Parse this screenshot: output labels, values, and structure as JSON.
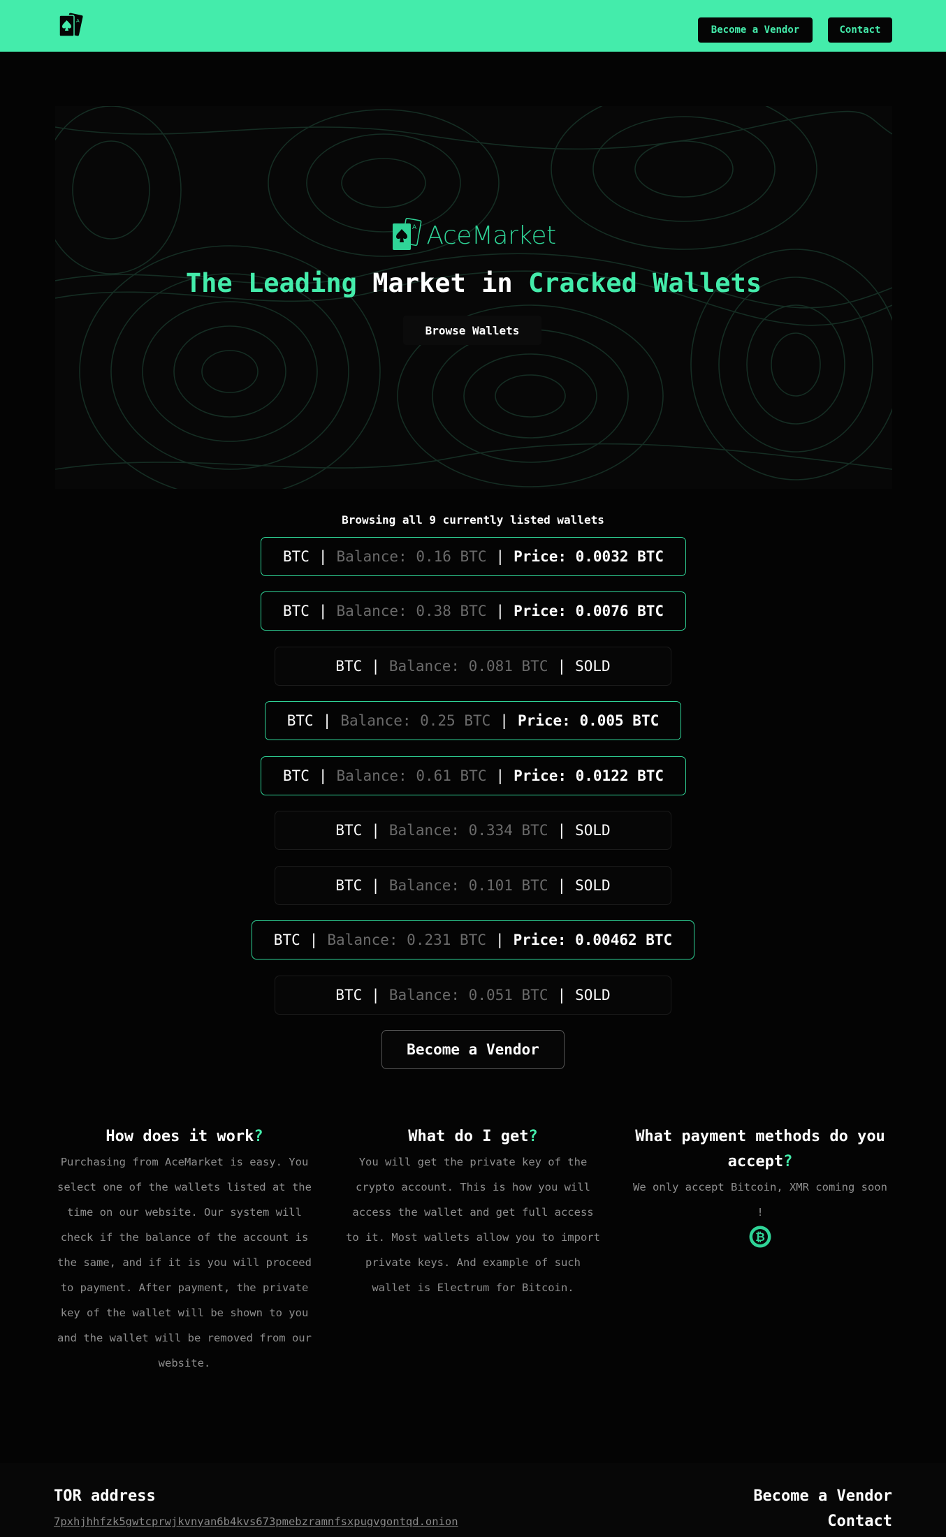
{
  "nav": {
    "become_vendor": "Become a Vendor",
    "contact": "Contact"
  },
  "hero": {
    "brand_name": "AceMarket",
    "title_part1": "The Leading",
    "title_part2": "Market in",
    "title_part3": "Cracked Wallets",
    "browse_button": "Browse Wallets"
  },
  "listing": {
    "caption": "Browsing all 9 currently listed wallets",
    "wallets": [
      {
        "coin": "BTC",
        "sep": "|",
        "balance": "Balance: 0.16 BTC",
        "status": "Price: 0.0032 BTC",
        "sold": false
      },
      {
        "coin": "BTC",
        "sep": "|",
        "balance": "Balance: 0.38 BTC",
        "status": "Price: 0.0076 BTC",
        "sold": false
      },
      {
        "coin": "BTC",
        "sep": "|",
        "balance": "Balance: 0.081 BTC",
        "status": "SOLD",
        "sold": true
      },
      {
        "coin": "BTC",
        "sep": "|",
        "balance": "Balance: 0.25 BTC",
        "status": "Price: 0.005 BTC",
        "sold": false
      },
      {
        "coin": "BTC",
        "sep": "|",
        "balance": "Balance: 0.61 BTC",
        "status": "Price: 0.0122 BTC",
        "sold": false
      },
      {
        "coin": "BTC",
        "sep": "|",
        "balance": "Balance: 0.334 BTC",
        "status": "SOLD",
        "sold": true
      },
      {
        "coin": "BTC",
        "sep": "|",
        "balance": "Balance: 0.101 BTC",
        "status": "SOLD",
        "sold": true
      },
      {
        "coin": "BTC",
        "sep": "|",
        "balance": "Balance: 0.231 BTC",
        "status": "Price: 0.00462 BTC",
        "sold": false
      },
      {
        "coin": "BTC",
        "sep": "|",
        "balance": "Balance: 0.051 BTC",
        "status": "SOLD",
        "sold": true
      }
    ],
    "vendor_button": "Become a Vendor"
  },
  "faq": [
    {
      "title": "How does it work",
      "mark": "?",
      "body": "Purchasing from AceMarket is easy. You select one of the wallets listed at the time on our website. Our system will check if the balance of the account is the same, and if it is you will proceed to payment. After payment, the private key of the wallet will be shown to you and the wallet will be removed from our website."
    },
    {
      "title": "What do I get",
      "mark": "?",
      "body": "You will get the private key of the crypto account. This is how you will access the wallet and get full access to it. Most wallets allow you to import private keys. And example of such wallet is Electrum for Bitcoin."
    },
    {
      "title": "What payment methods do you accept",
      "mark": "?",
      "body": "We only accept Bitcoin, XMR coming soon !",
      "icon": "bitcoin-icon"
    }
  ],
  "footer": {
    "tor_label": "TOR address",
    "tor_address": "7pxhjhhfzk5gwtcprwjkvnyan6b4kvs673pmebzramnfsxpugvgontqd.onion",
    "become_vendor": "Become a Vendor",
    "contact": "Contact"
  },
  "colors": {
    "accent": "#44ecab",
    "background": "#040404",
    "muted_text": "#8e8e8e"
  }
}
